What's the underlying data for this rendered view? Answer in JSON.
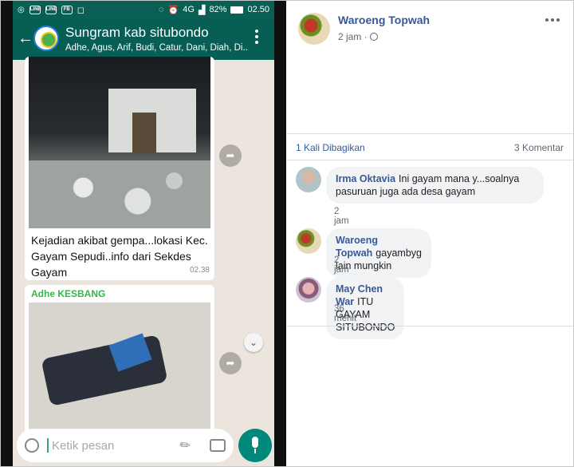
{
  "whatsapp": {
    "status": {
      "battery": "82%",
      "time": "02.50",
      "network": "4G",
      "icon_labels": [
        "LINE",
        "LINE",
        "FB"
      ]
    },
    "header": {
      "title": "Sungram kab situbondo",
      "members": "Adhe, Agus, Arif, Budi, Catur, Dani, Diah, Di..."
    },
    "messages": [
      {
        "caption": "Kejadian akibat gempa...lokasi Kec. Gayam Sepudi..info dari Sekdes Gayam",
        "time": "02.38"
      },
      {
        "sender": "Adhe KESBANG"
      }
    ],
    "input": {
      "placeholder": "Ketik pesan"
    }
  },
  "facebook": {
    "post": {
      "author": "Waroeng Topwah",
      "time": "2 jam ·"
    },
    "stats": {
      "shares": "1 Kali Dibagikan",
      "comments": "3 Komentar"
    },
    "comments": [
      {
        "author": "Irma Oktavia",
        "text": "Ini gayam mana y...soalnya pasuruan juga ada desa gayam",
        "time": "2 jam"
      },
      {
        "author": "Waroeng Topwah",
        "text": "gayambyg lain mungkin",
        "time": "2 jam"
      },
      {
        "author": "May Chen War",
        "text": "ITU GAYAM SITUBONDO",
        "time": "36 menit"
      }
    ]
  }
}
